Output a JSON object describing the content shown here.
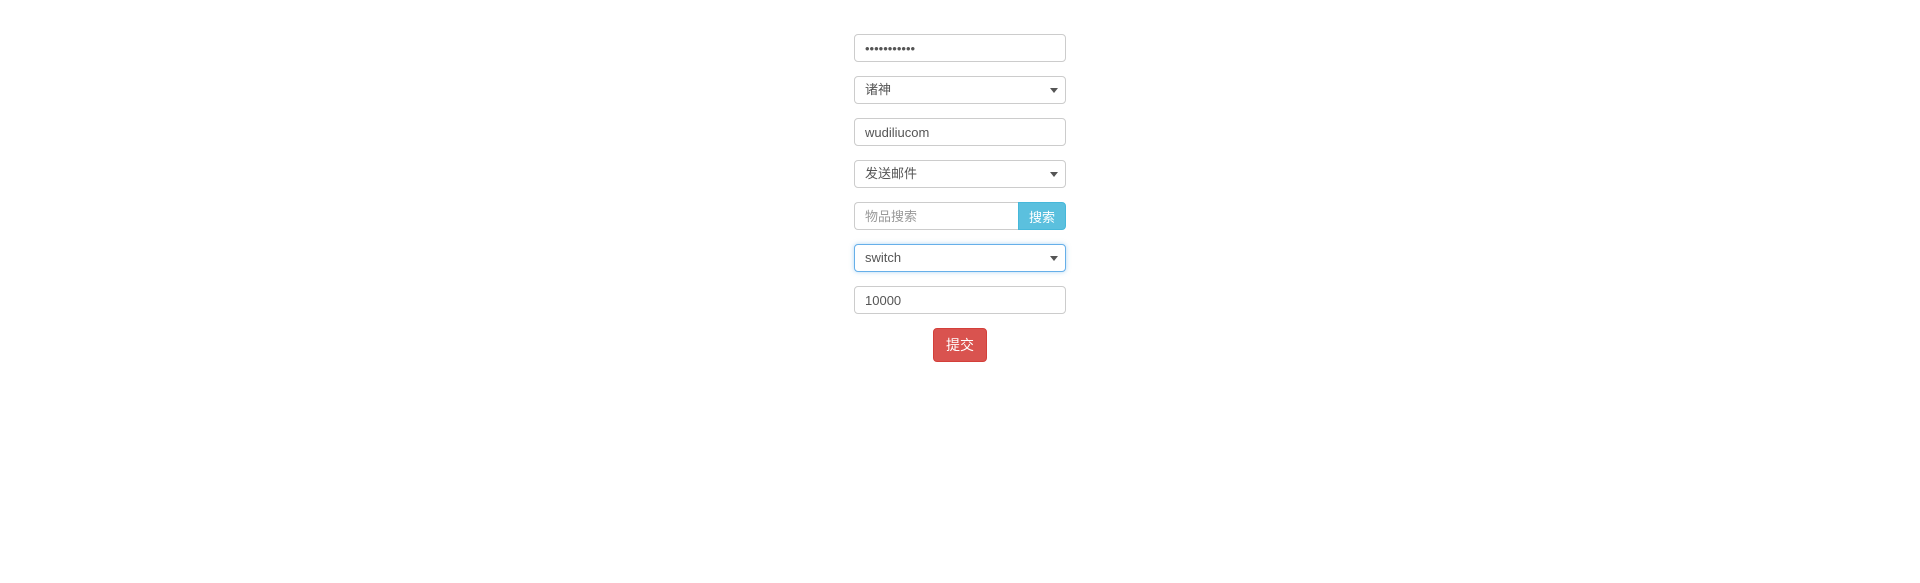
{
  "form": {
    "password": {
      "value": "•••••••••••"
    },
    "server_select": {
      "selected": "诸神"
    },
    "url_field": {
      "value": "wudiliucom"
    },
    "action_select": {
      "selected": "发送邮件"
    },
    "item_search": {
      "placeholder": "物品搜索",
      "value": ""
    },
    "search_button": "搜索",
    "type_select": {
      "selected": "switch"
    },
    "amount": {
      "value": "10000"
    },
    "submit_button": "提交"
  }
}
